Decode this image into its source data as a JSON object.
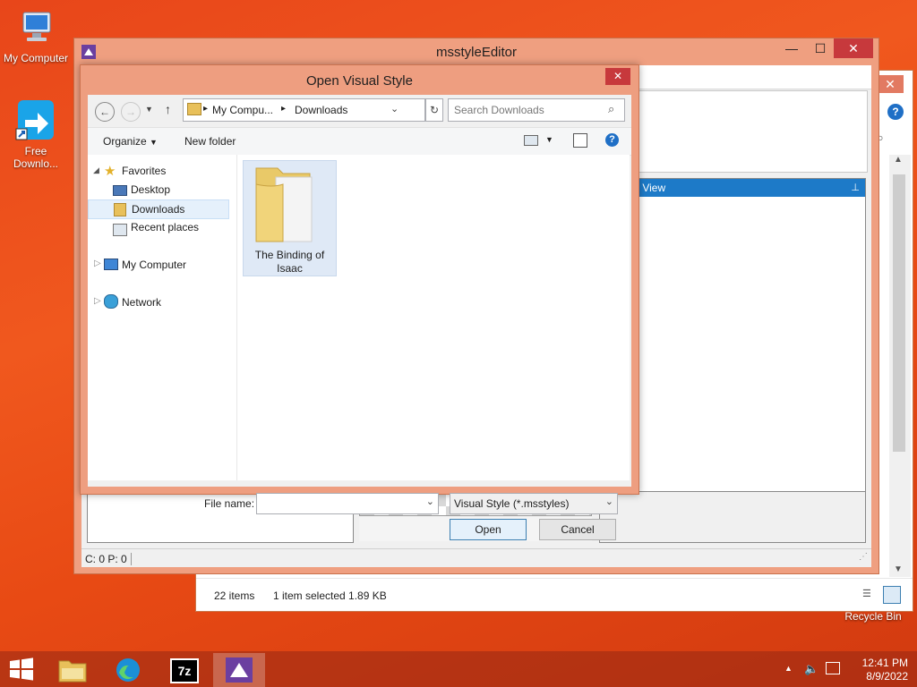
{
  "desktop": {
    "my_computer": "My Computer",
    "free_download": "Free Downlo...",
    "recycle_bin": "Recycle Bin"
  },
  "explorer_bg": {
    "item_count": "22 items",
    "selected": "1 item selected  1.89 KB"
  },
  "mse": {
    "title": "msstyleEditor",
    "panel_title": "y View",
    "status": "C: 0 P: 0"
  },
  "dialog": {
    "title": "Open Visual Style",
    "breadcrumb": [
      "My Compu...",
      "Downloads"
    ],
    "search_placeholder": "Search Downloads",
    "organize": "Organize",
    "new_folder": "New folder",
    "nav": {
      "favorites": "Favorites",
      "desktop": "Desktop",
      "downloads": "Downloads",
      "recent": "Recent places",
      "my_computer": "My Computer",
      "network": "Network"
    },
    "folder_line1": "The Binding of",
    "folder_line2": "Isaac",
    "file_name_label": "File name:",
    "file_name_value": "",
    "filter": "Visual Style (*.msstyles)",
    "open": "Open",
    "cancel": "Cancel"
  },
  "taskbar": {
    "time": "12:41 PM",
    "date": "8/9/2022"
  }
}
